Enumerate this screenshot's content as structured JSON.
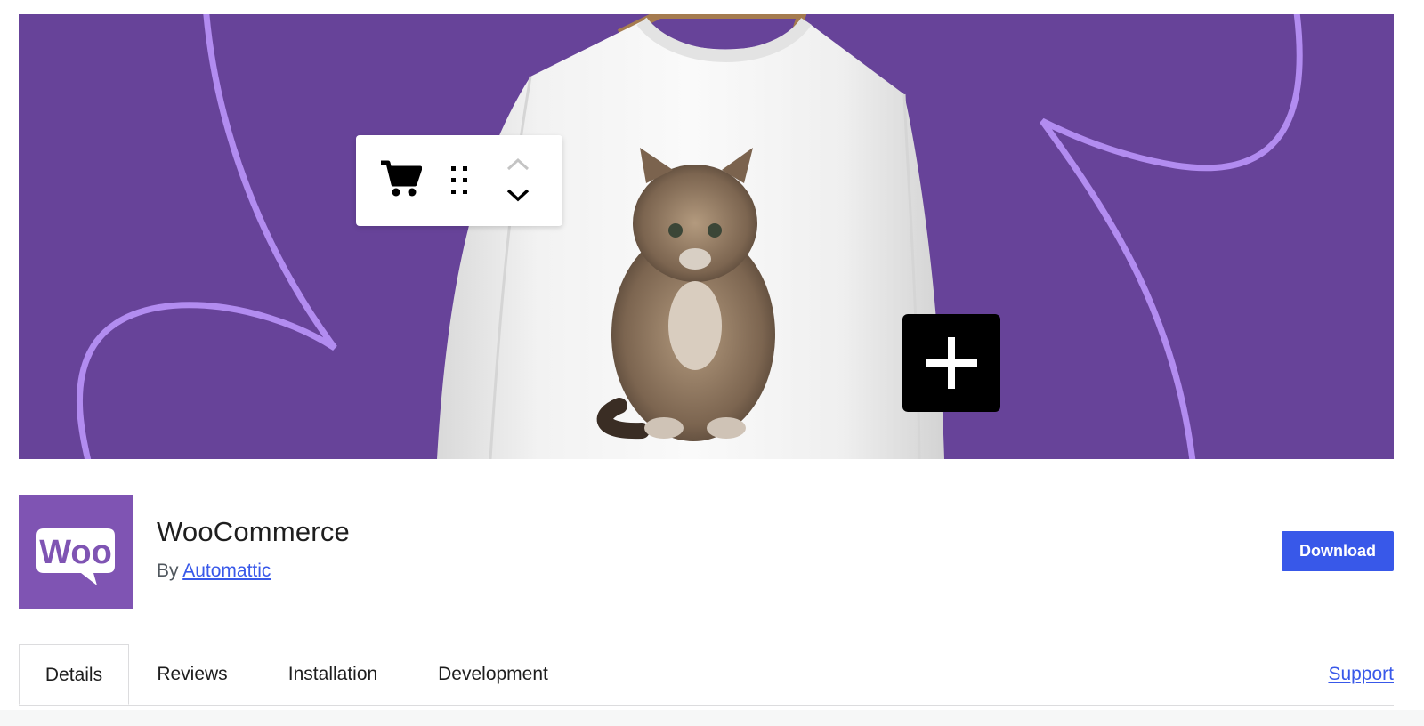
{
  "banner": {
    "background_color": "#674399",
    "curve_color": "#b28cf0",
    "toolbar_icons": [
      "cart-icon",
      "drag-handle-icon",
      "chevron-up-icon",
      "chevron-down-icon"
    ],
    "plus_icon": "plus-icon"
  },
  "plugin": {
    "icon_text": "Woo",
    "icon_color": "#7f54b3",
    "name": "WooCommerce",
    "by_label": "By",
    "author": "Automattic"
  },
  "actions": {
    "download_label": "Download",
    "accent_color": "#3858e9"
  },
  "tabs": [
    {
      "label": "Details",
      "active": true
    },
    {
      "label": "Reviews",
      "active": false
    },
    {
      "label": "Installation",
      "active": false
    },
    {
      "label": "Development",
      "active": false
    }
  ],
  "support_label": "Support"
}
